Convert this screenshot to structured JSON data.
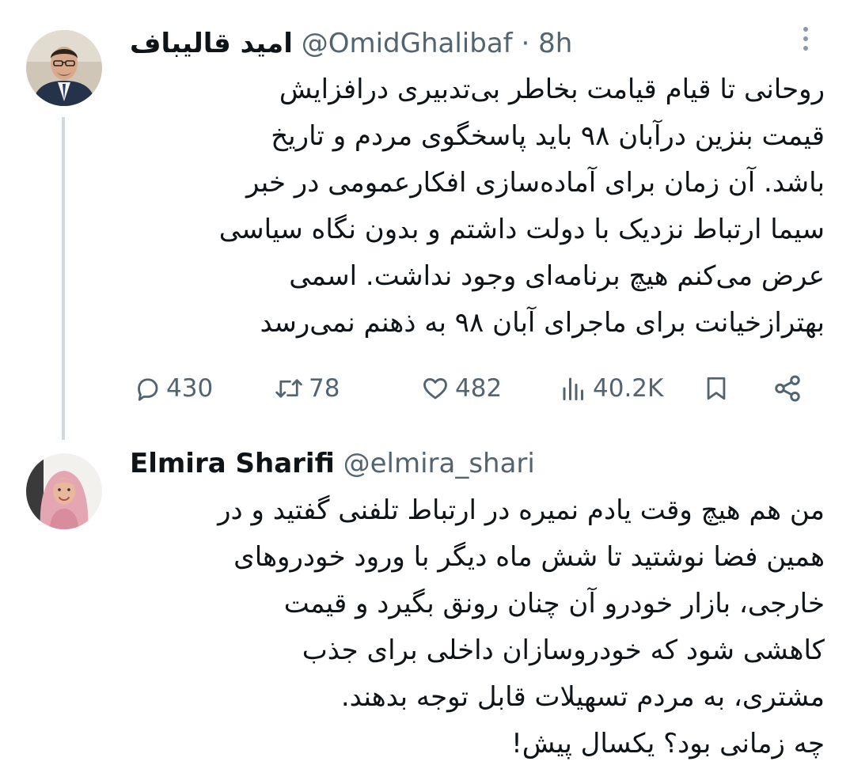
{
  "tweets": [
    {
      "display_name": "امید قالیباف",
      "handle": "@OmidGhalibaf",
      "separator": "·",
      "time": "8h",
      "lines": [
        "روحانی تا قیام قیامت بخاطر بی‌تدبیری درافزایش",
        "قیمت بنزین درآبان ۹۸ باید پاسخگوی مردم و تاریخ",
        "باشد. آن زمان برای آماده‌سازی افکارعمومی در خبر",
        "سیما ارتباط نزدیک با دولت داشتم و بدون نگاه سیاسی",
        "عرض می‌کنم هیچ برنامه‌ای وجود نداشت. اسمی",
        "بهترازخیانت برای ماجرای آبان ۹۸ به ذهنم نمی‌رسد"
      ],
      "actions": {
        "replies": "430",
        "retweets": "78",
        "likes": "482",
        "views": "40.2K"
      },
      "icons": [
        "more-icon",
        "reply-icon",
        "retweet-icon",
        "like-icon",
        "views-icon",
        "bookmark-icon",
        "share-icon"
      ]
    },
    {
      "display_name": "Elmira Sharifi",
      "handle": "@elmira_shari",
      "lines": [
        "من هم هیچ وقت یادم نمیره در ارتباط تلفنی گفتید و در",
        "همین فضا نوشتید تا شش ماه دیگر با ورود خودروهای",
        "خارجی، بازار خودرو آن چنان رونق بگیرد و قیمت",
        "کاهشی شود که خودروسازان داخلی برای جذب",
        "مشتری، به مردم تسهیلات قابل توجه بدهند.",
        "چه زمانی بود؟ یکسال پیش!"
      ]
    }
  ],
  "colors": {
    "text": "#0f1419",
    "secondary": "#536471",
    "thread_line": "#cfd9de"
  }
}
